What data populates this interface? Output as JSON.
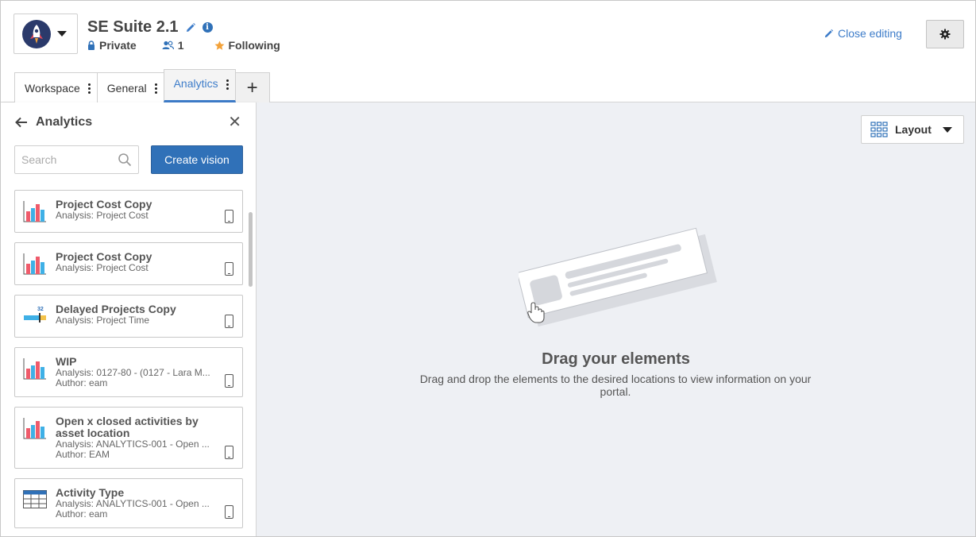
{
  "header": {
    "title": "SE Suite 2.1",
    "privacy": "Private",
    "members": "1",
    "following": "Following",
    "close_editing": "Close editing"
  },
  "tabs": [
    {
      "label": "Workspace"
    },
    {
      "label": "General"
    },
    {
      "label": "Analytics",
      "active": true
    }
  ],
  "sidebar": {
    "title": "Analytics",
    "search_placeholder": "Search",
    "create_button": "Create vision",
    "items": [
      {
        "name": "Project Cost Copy",
        "analysis": "Analysis: Project Cost",
        "author": "",
        "icon": "bar-chart-icon"
      },
      {
        "name": "Project Cost Copy",
        "analysis": "Analysis: Project Cost",
        "author": "",
        "icon": "bar-chart-icon"
      },
      {
        "name": "Delayed Projects Copy",
        "analysis": "Analysis: Project Time",
        "author": "",
        "icon": "kpi-gauge-icon",
        "icon_value": "32"
      },
      {
        "name": "WIP",
        "analysis": "Analysis: 0127-80 - (0127 - Lara M...",
        "author": "Author: eam",
        "icon": "bar-chart-icon"
      },
      {
        "name": "Open x closed activities by asset location",
        "analysis": "Analysis: ANALYTICS-001 - Open ...",
        "author": "Author: EAM",
        "icon": "bar-chart-icon"
      },
      {
        "name": "Activity Type",
        "analysis": "Analysis: ANALYTICS-001 - Open ...",
        "author": "Author: eam",
        "icon": "table-icon"
      }
    ]
  },
  "main": {
    "layout_button": "Layout",
    "empty_title": "Drag your elements",
    "empty_description": "Drag and drop the elements to the desired locations to view information on your portal."
  },
  "colors": {
    "accent": "#3071b8",
    "link": "#3d7cc9",
    "canvas": "#eef0f4",
    "chart_red": "#ef5b6b",
    "chart_blue": "#3fb0e6"
  }
}
